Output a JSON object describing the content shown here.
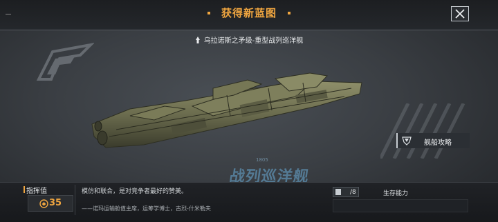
{
  "header": {
    "title": "获得新蓝图",
    "close_icon": "close-icon"
  },
  "ship": {
    "name": "乌拉诺斯之矛级-重型战列巡洋舰",
    "class_watermark": "战列巡洋舰",
    "hull_code": "1805"
  },
  "guide_button": {
    "label": "舰船攻略",
    "icon": "guide-shield-icon"
  },
  "commander": {
    "label": "指挥值",
    "value": "35",
    "icon": "command-coin-icon"
  },
  "description": {
    "quote": "模仿和联合，是对竞争者最好的赞美。",
    "attribution": "——诺玛运输舱值主席，运筹学博士，古烈-什米勒夫"
  },
  "stats": {
    "count_value": "/8",
    "survival_label": "生存能力"
  },
  "colors": {
    "accent": "#f0a640",
    "watermark": "#5d8fb0"
  }
}
